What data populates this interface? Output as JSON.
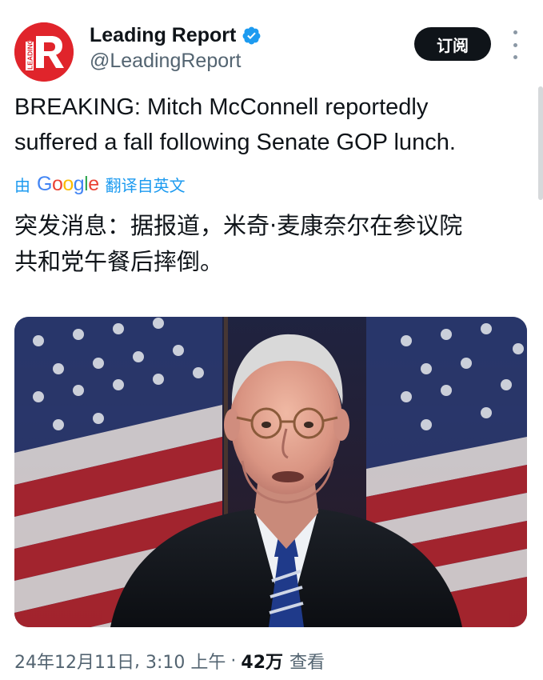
{
  "author": {
    "display_name": "Leading Report",
    "handle": "@LeadingReport",
    "verified": true,
    "avatar_text": "LEADING"
  },
  "actions": {
    "subscribe_label": "订阅"
  },
  "tweet": {
    "text_line_1": "BREAKING: Mitch McConnell reportedly",
    "text_line_2": "suffered a fall following Senate GOP lunch.",
    "translate_prefix": "由",
    "translate_brand": "Google",
    "translate_suffix": "翻译自英文",
    "translated_line_1": "突发消息：据报道，米奇·麦康奈尔在参议院",
    "translated_line_2": "共和党午餐后摔倒。"
  },
  "meta": {
    "date": "24年12月11日",
    "time": "3:10 上午",
    "separator": "·",
    "views_count": "42万",
    "views_label": "查看"
  },
  "icons": {
    "verified": "verified-badge-icon",
    "more": "more-vertical-icon"
  },
  "colors": {
    "brand_red": "#e0242b",
    "link_blue": "#1d9bf0",
    "verified_blue": "#1d9bf0",
    "text_primary": "#0f1419",
    "text_secondary": "#536471"
  }
}
